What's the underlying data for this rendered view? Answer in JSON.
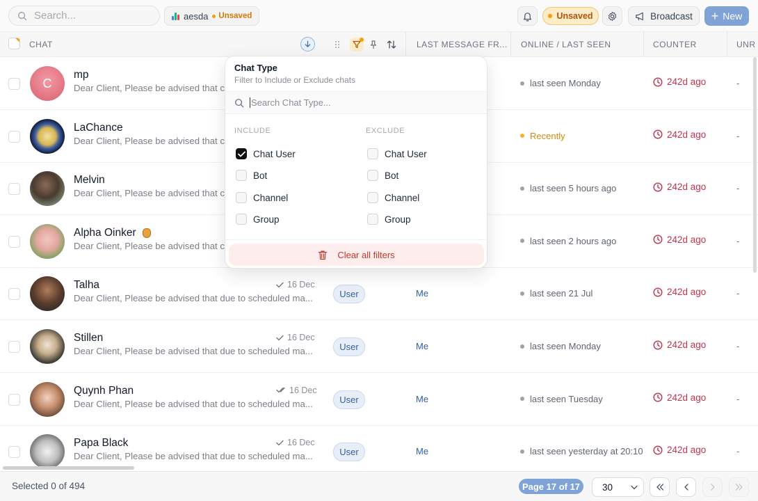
{
  "topbar": {
    "search_placeholder": "Search...",
    "view_name": "aesda",
    "view_status": "Unsaved",
    "unsaved_label": "Unsaved",
    "broadcast_label": "Broadcast",
    "new_label": "New"
  },
  "columns": {
    "chat": "CHAT",
    "last_message_from": "LAST MESSAGE FR...",
    "online_last_seen": "ONLINE / LAST SEEN",
    "counter": "COUNTER",
    "unread": "UNR"
  },
  "filter_popover": {
    "title": "Chat Type",
    "subtitle": "Filter to Include or Exclude chats",
    "search_placeholder": "Search Chat Type...",
    "include_label": "INCLUDE",
    "exclude_label": "EXCLUDE",
    "include_options": [
      {
        "label": "Chat User",
        "checked": true
      },
      {
        "label": "Bot",
        "checked": false
      },
      {
        "label": "Channel",
        "checked": false
      },
      {
        "label": "Group",
        "checked": false
      }
    ],
    "exclude_options": [
      {
        "label": "Chat User",
        "checked": false
      },
      {
        "label": "Bot",
        "checked": false
      },
      {
        "label": "Channel",
        "checked": false
      },
      {
        "label": "Group",
        "checked": false
      }
    ],
    "clear_label": "Clear all filters"
  },
  "rows": [
    {
      "name": "mp",
      "avatar_initial": "C",
      "preview": "Dear Client, Please be advised that c",
      "date": "",
      "type": "",
      "from": "",
      "seen": "last seen Monday",
      "recent": false,
      "counter": "242d ago",
      "unread": "-"
    },
    {
      "name": "LaChance",
      "avatar_initial": "",
      "preview": "Dear Client, Please be advised that c",
      "date": "",
      "type": "",
      "from": "",
      "seen": "Recently",
      "recent": true,
      "counter": "242d ago",
      "unread": "-"
    },
    {
      "name": "Melvin",
      "avatar_initial": "",
      "preview": "Dear Client, Please be advised that c",
      "date": "",
      "type": "",
      "from": "",
      "seen": "last seen 5 hours ago",
      "recent": false,
      "counter": "242d ago",
      "unread": "-"
    },
    {
      "name": "Alpha Oinker",
      "avatar_initial": "",
      "preview": "Dear Client, Please be advised that c",
      "date": "",
      "type": "",
      "from": "",
      "seen": "last seen 2 hours ago",
      "recent": false,
      "counter": "242d ago",
      "unread": "-"
    },
    {
      "name": "Talha",
      "avatar_initial": "",
      "preview": "Dear Client, Please be advised that due to scheduled ma...",
      "date": "16 Dec",
      "type": "User",
      "from": "Me",
      "seen": "last seen 21 Jul",
      "recent": false,
      "counter": "242d ago",
      "unread": "-"
    },
    {
      "name": "Stillen",
      "avatar_initial": "",
      "preview": "Dear Client, Please be advised that due to scheduled ma...",
      "date": "16 Dec",
      "type": "User",
      "from": "Me",
      "seen": "last seen Monday",
      "recent": false,
      "counter": "242d ago",
      "unread": "-"
    },
    {
      "name": "Quynh Phan",
      "avatar_initial": "",
      "preview": "Dear Client, Please be advised that due to scheduled ma...",
      "date": "16 Dec",
      "type": "User",
      "from": "Me",
      "seen": "last seen Tuesday",
      "recent": false,
      "counter": "242d ago",
      "unread": "-"
    },
    {
      "name": "Papa Black",
      "avatar_initial": "",
      "preview": "Dear Client, Please be advised that due to scheduled ma...",
      "date": "16 Dec",
      "type": "User",
      "from": "Me",
      "seen": "last seen yesterday at 20:10",
      "recent": false,
      "counter": "242d ago",
      "unread": "-"
    }
  ],
  "footer": {
    "selected_text": "Selected 0 of 494",
    "page_label": "Page 17 of 17",
    "per_page": "30"
  },
  "colors": {
    "accent": "#7fa3d6",
    "counter_red": "#c0344d",
    "unsaved_amber": "#f59e0b"
  }
}
